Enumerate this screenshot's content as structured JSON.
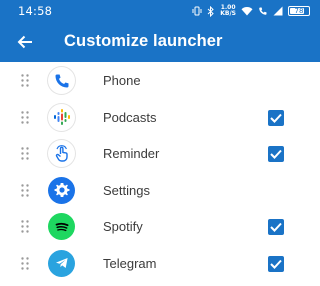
{
  "status_bar": {
    "time": "14:58",
    "speed_value": "1.00",
    "speed_unit": "KB/S",
    "battery": "78",
    "battery_level": 0.78
  },
  "app_bar": {
    "title": "Customize launcher",
    "back_icon": "arrow-back-icon"
  },
  "colors": {
    "accent": "#1a73c6",
    "checkbox": "#1a73c6",
    "text": "#3c3c3c"
  },
  "apps": [
    {
      "label": "Phone",
      "icon": "phone-icon",
      "checked": false
    },
    {
      "label": "Podcasts",
      "icon": "podcasts-icon",
      "checked": true
    },
    {
      "label": "Reminder",
      "icon": "reminder-icon",
      "checked": true
    },
    {
      "label": "Settings",
      "icon": "settings-icon",
      "checked": false
    },
    {
      "label": "Spotify",
      "icon": "spotify-icon",
      "checked": true
    },
    {
      "label": "Telegram",
      "icon": "telegram-icon",
      "checked": true
    }
  ]
}
